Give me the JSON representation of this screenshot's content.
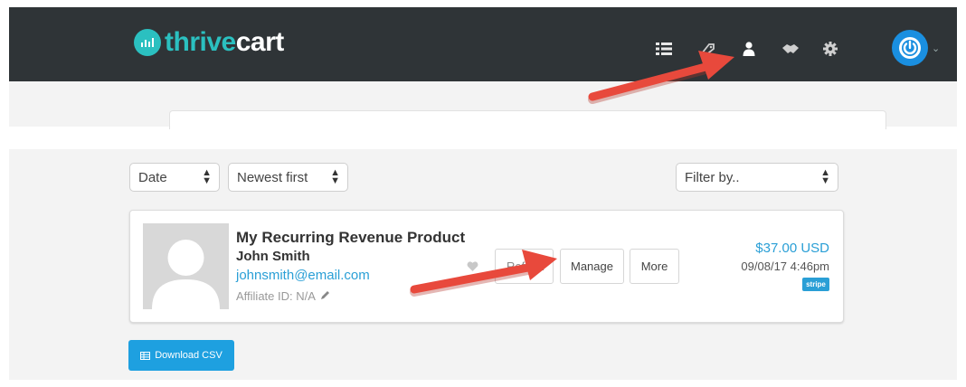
{
  "header": {
    "brand": {
      "part1": "thrive",
      "part2": "cart"
    },
    "nav_icons": [
      "list-icon",
      "affiliate-tag-icon",
      "user-icon",
      "handshake-icon",
      "settings-gear-icon"
    ],
    "account_icon": "power-icon",
    "colors": {
      "header_bg": "#2f3437",
      "brand_accent": "#2bc0c0",
      "account_blue": "#1a8fe0"
    }
  },
  "filters": {
    "sort_field": "Date",
    "sort_order": "Newest first",
    "filter_placeholder": "Filter by.."
  },
  "order": {
    "product_name": "My Recurring Revenue Product",
    "customer_name": "John Smith",
    "customer_email": "johnsmith@email.com",
    "affiliate": "Affiliate ID: N/A",
    "buttons": {
      "refund": "Refund",
      "manage": "Manage",
      "more": "More"
    },
    "price": "$37.00 USD",
    "date": "09/08/17 4:46pm",
    "gateway": "stripe"
  },
  "actions": {
    "download_csv": "Download CSV"
  },
  "annotations": {
    "arrow_color": "#e8493c"
  }
}
